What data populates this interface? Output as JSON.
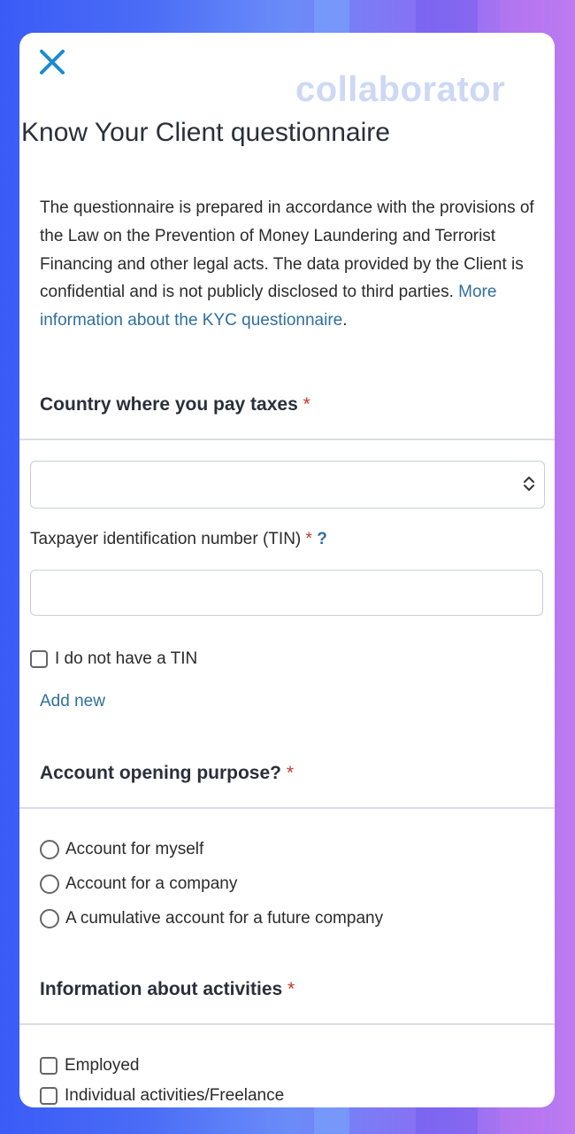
{
  "watermark": "collaborator",
  "page_title": "Know Your Client questionnaire",
  "intro": {
    "text": "The questionnaire is prepared in accordance with the provisions of the Law on the Prevention of Money Laundering and Terrorist Financing and other legal acts. The data provided by the Client is confidential and is not publicly disclosed to third parties. ",
    "link": "More information about the KYC questionnaire",
    "end": "."
  },
  "tax": {
    "section_title": "Country where you pay taxes",
    "required_mark": "*",
    "country_select_value": "",
    "tin_label": "Taxpayer identification number (TIN)",
    "tin_required_mark": "*",
    "tin_help": "?",
    "tin_value": "",
    "no_tin_label": "I do not have a TIN",
    "add_new": "Add new"
  },
  "purpose": {
    "section_title": "Account opening purpose?",
    "required_mark": "*",
    "options": [
      "Account for myself",
      "Account for a company",
      "A cumulative account for a future company"
    ]
  },
  "activities": {
    "section_title": "Information about activities",
    "required_mark": "*",
    "options": [
      "Employed",
      "Individual activities/Freelance"
    ]
  },
  "colors": {
    "accent": "#1a8ccf",
    "link": "#2f6f9f",
    "required": "#c0392b",
    "watermark": "#cdd8f4"
  },
  "icons": [
    "close-icon",
    "select-arrows-icon"
  ]
}
